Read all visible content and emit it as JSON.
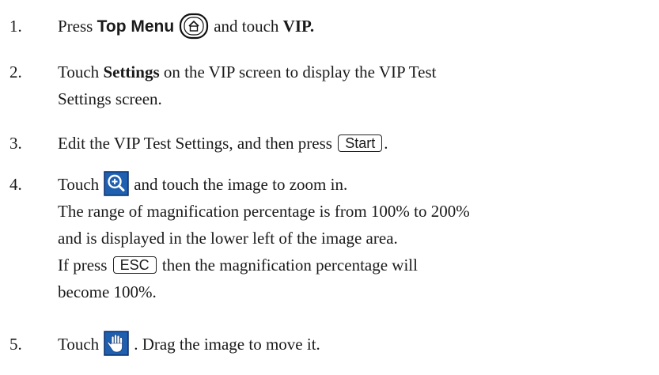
{
  "steps": [
    {
      "number": "1.",
      "press": "Press",
      "button": "Top Menu",
      "mid": "and touch",
      "target": "VIP."
    },
    {
      "number": "2.",
      "touch": "Touch",
      "target": "Settings",
      "line1_rest": "on the VIP screen to display the VIP Test",
      "line2": "Settings screen."
    },
    {
      "number": "3.",
      "text": "Edit the VIP Test Settings, and then press",
      "key": "Start",
      "end": "."
    },
    {
      "number": "4.",
      "touch": "Touch",
      "line1_rest": "and touch the image to zoom in.",
      "line2": "The range of magnification percentage is from 100% to 200%",
      "line3": "and is displayed in the lower left of the image area.",
      "line4_pre": "If press",
      "key": "ESC",
      "line4_post": "then the magnification percentage will",
      "line5": "become 100%."
    },
    {
      "number": "5.",
      "touch": "Touch",
      "rest": ". Drag the image to move it."
    }
  ],
  "icons": {
    "top_menu": "home-icon",
    "zoom": "zoom-in-icon",
    "pan": "hand-icon"
  },
  "colors": {
    "icon_blue": "#1f5fb0",
    "icon_border": "#0c2f6a"
  }
}
